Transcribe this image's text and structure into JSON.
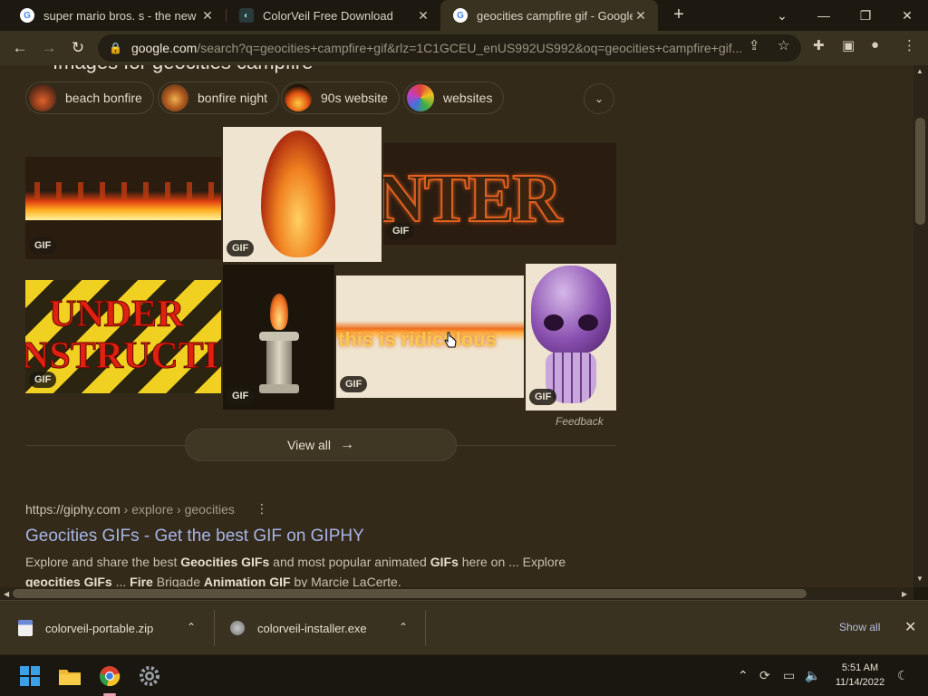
{
  "browser": {
    "tabs": [
      {
        "title": "super mario bros. s - the new de",
        "favicon": "google-icon"
      },
      {
        "title": "ColorVeil Free Download",
        "favicon": "colorveil-icon"
      },
      {
        "title": "geocities campfire gif - Google S",
        "favicon": "google-icon"
      }
    ],
    "url_host": "google.com",
    "url_path": "/search?q=geocities+campfire+gif&rlz=1C1GCEU_enUS992US992&oq=geocities+campfire+gif..."
  },
  "images_section": {
    "heading": "Images for geocities campfire",
    "chips": [
      {
        "label": "beach bonfire"
      },
      {
        "label": "bonfire night"
      },
      {
        "label": "90s website"
      },
      {
        "label": "websites"
      }
    ],
    "badge_label": "GIF",
    "images": [
      {
        "alt": "fire strip",
        "badge": "GIF"
      },
      {
        "alt": "flame",
        "badge": "GIF"
      },
      {
        "alt": "enter",
        "badge": "GIF"
      },
      {
        "alt": "under construction",
        "badge": "GIF"
      },
      {
        "alt": "torch",
        "badge": "GIF"
      },
      {
        "alt": "this is ridiculous",
        "badge": "GIF"
      },
      {
        "alt": "skull",
        "badge": "GIF"
      }
    ],
    "enter_text": "NTER",
    "under_text": "UNDER",
    "construct_text": "NSTRUCTI",
    "ridiculous_text": "this is ridiculous",
    "feedback": "Feedback",
    "view_all": "View all"
  },
  "result": {
    "url": "https://giphy.com",
    "crumbs": " › explore › geocities",
    "title": "Geocities GIFs - Get the best GIF on GIPHY",
    "snippet_parts": [
      {
        "t": "Explore and share the best ",
        "b": false
      },
      {
        "t": "Geocities GIFs",
        "b": true
      },
      {
        "t": " and most popular animated ",
        "b": false
      },
      {
        "t": "GIFs",
        "b": true
      },
      {
        "t": " here on ... Explore ",
        "b": false
      },
      {
        "t": "geocities GIFs",
        "b": true
      },
      {
        "t": " ... ",
        "b": false
      },
      {
        "t": "Fire",
        "b": true
      },
      {
        "t": " Brigade ",
        "b": false
      },
      {
        "t": "Animation GIF",
        "b": true
      },
      {
        "t": " by Marcie LaCerte.",
        "b": false
      }
    ]
  },
  "downloads": {
    "items": [
      {
        "name": "colorveil-portable.zip"
      },
      {
        "name": "colorveil-installer.exe"
      }
    ],
    "show_all": "Show all"
  },
  "taskbar": {
    "time": "5:51 AM",
    "date": "11/14/2022"
  },
  "colors": {
    "page_bg": "#332a1a",
    "link": "#a6b4e6",
    "toolbar_bg": "#3a3220"
  }
}
